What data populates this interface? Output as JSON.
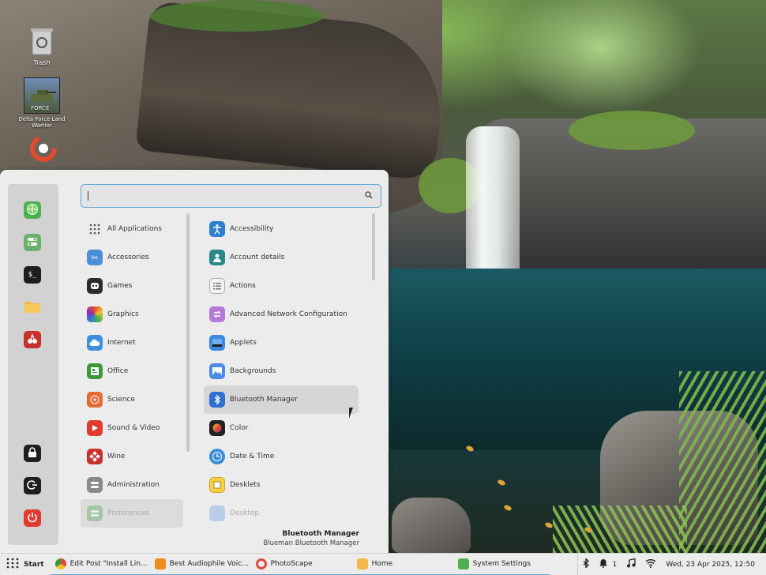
{
  "desktop": {
    "icons": [
      {
        "label": "Trash",
        "icon": "trash-icon"
      },
      {
        "label": "Delta Force Land Warrior",
        "icon": "game-icon"
      },
      {
        "label": "",
        "icon": "photoscape-icon"
      }
    ]
  },
  "menu": {
    "search": {
      "value": "",
      "placeholder": ""
    },
    "favorites": [
      {
        "icon": "browser-icon"
      },
      {
        "icon": "settings-toggle-icon"
      },
      {
        "icon": "terminal-icon"
      },
      {
        "icon": "folder-icon"
      },
      {
        "icon": "app-red-icon"
      }
    ],
    "session": [
      {
        "icon": "lock-icon"
      },
      {
        "icon": "logout-icon"
      },
      {
        "icon": "power-icon"
      }
    ],
    "categories": [
      {
        "label": "All Applications",
        "icon": "grid-icon",
        "color": "transparent"
      },
      {
        "label": "Accessories",
        "icon": "scissors-icon",
        "color": "#4a90d9"
      },
      {
        "label": "Games",
        "icon": "gamepad-icon",
        "color": "#2c2c2c"
      },
      {
        "label": "Graphics",
        "icon": "palette-icon",
        "color": "#e0522d"
      },
      {
        "label": "Internet",
        "icon": "cloud-icon",
        "color": "#3f8fe0"
      },
      {
        "label": "Office",
        "icon": "office-icon",
        "color": "#3a9a3a"
      },
      {
        "label": "Science",
        "icon": "atom-icon",
        "color": "#e86a33"
      },
      {
        "label": "Sound & Video",
        "icon": "play-icon",
        "color": "#e23a2e"
      },
      {
        "label": "Wine",
        "icon": "wine-icon",
        "color": "#c9302c"
      },
      {
        "label": "Administration",
        "icon": "admin-icon",
        "color": "#8a8a8a"
      },
      {
        "label": "Preferences",
        "icon": "prefs-icon",
        "color": "#5cae5c"
      }
    ],
    "apps": [
      {
        "label": "Accessibility",
        "icon": "accessibility-icon",
        "color": "#2f7fd0"
      },
      {
        "label": "Account details",
        "icon": "user-icon",
        "color": "#2a8a8a"
      },
      {
        "label": "Actions",
        "icon": "list-icon",
        "color": "#e5e5e5"
      },
      {
        "label": "Advanced Network Configuration",
        "icon": "network-icon",
        "color": "#b57ad6"
      },
      {
        "label": "Applets",
        "icon": "applets-icon",
        "color": "#3a8ae0"
      },
      {
        "label": "Backgrounds",
        "icon": "backgrounds-icon",
        "color": "#4b8de6"
      },
      {
        "label": "Bluetooth Manager",
        "icon": "bluetooth-icon",
        "color": "#2f6fd4"
      },
      {
        "label": "Color",
        "icon": "color-icon",
        "color": "#222222"
      },
      {
        "label": "Date & Time",
        "icon": "clock-icon",
        "color": "#3a8ed8"
      },
      {
        "label": "Desklets",
        "icon": "desklets-icon",
        "color": "#f2d14a"
      },
      {
        "label": "Desktop",
        "icon": "desktop-icon",
        "color": "#7aa8e0"
      }
    ],
    "selected_app": {
      "title": "Bluetooth Manager",
      "subtitle": "Blueman Bluetooth Manager"
    }
  },
  "taskbar": {
    "start_label": "Start",
    "tasks": [
      {
        "label": "Edit Post \"Install Lin...",
        "icon": "chrome-icon",
        "color": "#e04a3a"
      },
      {
        "label": "Best Audiophile Voic...",
        "icon": "vlc-icon",
        "color": "#f08a1e"
      },
      {
        "label": "PhotoScape",
        "icon": "photoscape-icon",
        "color": "#e04a3a"
      },
      {
        "label": "Home",
        "icon": "folder-icon",
        "color": "#f2b94a"
      },
      {
        "label": "System Settings",
        "icon": "settings-icon",
        "color": "#4caf50"
      }
    ],
    "tray": {
      "notifications": "1",
      "clock": "Wed, 23 Apr  2025, 12:50"
    }
  }
}
